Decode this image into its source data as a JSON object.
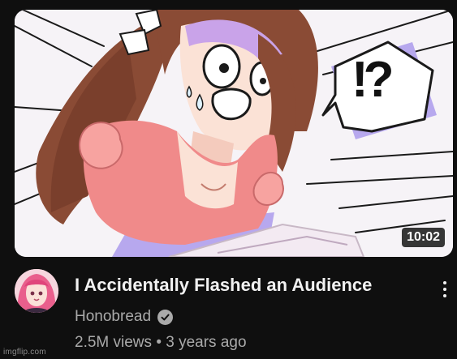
{
  "video": {
    "title": "I Accidentally Flashed an Audience",
    "duration": "10:02",
    "channel": "Honobread",
    "views": "2.5M views",
    "separator": "•",
    "age": "3 years ago",
    "speech_bubble": "!?"
  },
  "watermark": "imgflip.com",
  "icons": {
    "verified": "verified-check-icon",
    "menu": "more-vert-icon"
  },
  "colors": {
    "background": "#0f0f0f",
    "title": "#f1f1f1",
    "secondary_text": "#aaaaaa",
    "hair": "#8a4b35",
    "shirt": "#f08a8a"
  }
}
